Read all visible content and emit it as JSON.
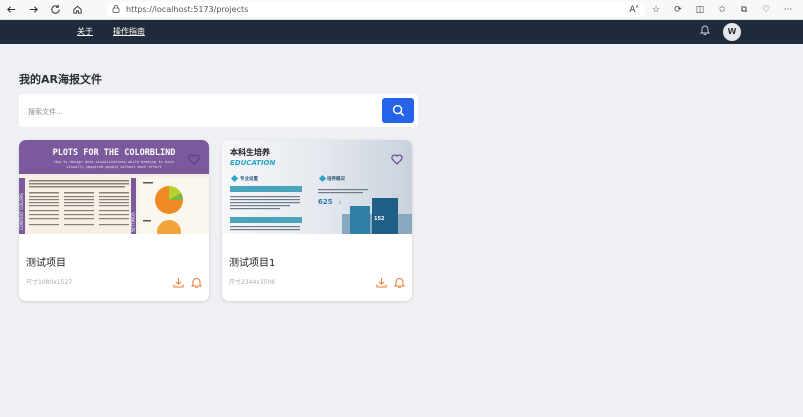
{
  "browser": {
    "url": "https://localhost:5173/projects"
  },
  "header": {
    "nav": [
      "关于",
      "操作指南"
    ],
    "avatar_initial": "W"
  },
  "page": {
    "title": "我的AR海报文件",
    "search": {
      "placeholder": "搜索文件..."
    }
  },
  "projects": [
    {
      "name": "测试项目",
      "size": "尺寸1080x1527",
      "poster": {
        "title": "PLOTS FOR THE COLORBLIND",
        "subtitle1": "How to design data visualizations while keeping in mind",
        "subtitle2": "visually impaired people without much effort",
        "side": "CONTEXT COLORS",
        "side2": "SETTINGS"
      }
    },
    {
      "name": "测试项目1",
      "size": "尺寸2344x3506",
      "poster": {
        "title": "本科生培养",
        "subtitle": "EDUCATION",
        "sec1": "专业设置",
        "sec2": "培养概况",
        "stat": "625",
        "stat_unit": "人",
        "stat2": "152"
      }
    }
  ],
  "colors": {
    "header_bg": "#1f2a3a",
    "accent": "#2563eb",
    "action_orange": "#e8772e",
    "favorite_purple": "#5b3f8c"
  }
}
